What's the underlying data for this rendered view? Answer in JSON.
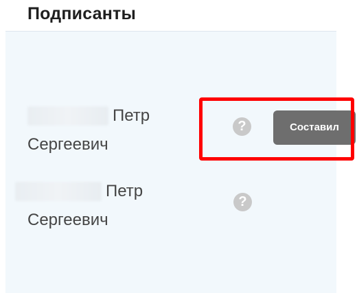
{
  "section": {
    "title": "Подписанты"
  },
  "signers": [
    {
      "first_name": "Петр",
      "patronymic": "Сергеевич",
      "help_icon": "question-circle-icon"
    },
    {
      "first_name": "Петр",
      "patronymic": "Сергеевич",
      "help_icon": "question-circle-icon"
    }
  ],
  "tooltip": {
    "text": "Составил"
  },
  "colors": {
    "panel_background": "#f2f8fc",
    "highlight_border": "#ff0000",
    "tooltip_background": "#6e6e6e",
    "help_icon": "#c9c9c9"
  }
}
